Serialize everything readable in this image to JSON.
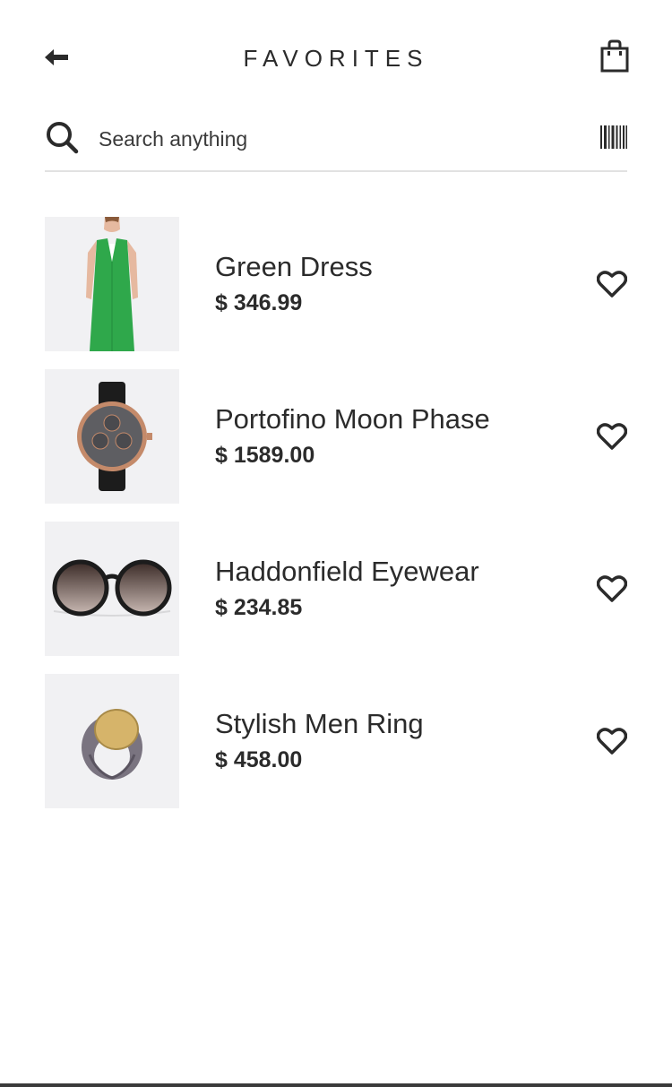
{
  "header": {
    "back_icon": "arrow-left-icon",
    "title": "FAVORITES",
    "bag_icon": "shopping-bag-icon"
  },
  "search": {
    "icon": "search-icon",
    "placeholder": "Search anything",
    "barcode_icon": "barcode-icon"
  },
  "favorites": {
    "items": [
      {
        "name": "Green Dress",
        "price": "$ 346.99",
        "image": "green-dress",
        "heart_icon": "heart-icon"
      },
      {
        "name": "Portofino Moon Phase",
        "price": "$ 1589.00",
        "image": "watch",
        "heart_icon": "heart-icon"
      },
      {
        "name": "Haddonfield Eyewear",
        "price": "$ 234.85",
        "image": "sunglasses",
        "heart_icon": "heart-icon"
      },
      {
        "name": "Stylish Men Ring",
        "price": "$ 458.00",
        "image": "ring",
        "heart_icon": "heart-icon"
      }
    ]
  },
  "colors": {
    "text": "#2b2b2b",
    "thumb_bg": "#f1f1f3",
    "divider": "#e2e2e2",
    "dress_green": "#2fa84b"
  }
}
